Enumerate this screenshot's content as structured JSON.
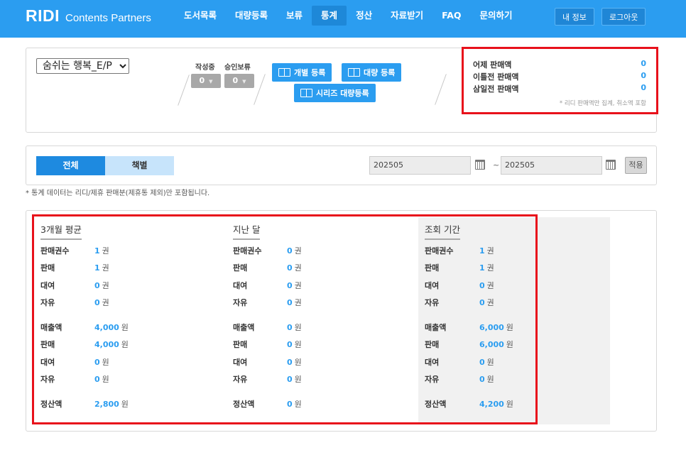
{
  "header": {
    "logo_mark": "RIDI",
    "logo_sub": "Contents Partners",
    "nav": [
      "도서목록",
      "대량등록",
      "보류",
      "통계",
      "정산",
      "자료받기",
      "FAQ",
      "문의하기"
    ],
    "active_nav": "통계",
    "my_info": "내 정보",
    "logout": "로그아웃"
  },
  "publisher": {
    "selected": "숨쉬는 행복_E/P",
    "counters": [
      {
        "label": "작성중",
        "value": "0"
      },
      {
        "label": "승인보류",
        "value": "0"
      }
    ],
    "buttons": {
      "individual": "개별 등록",
      "bulk": "대량 등록",
      "series_bulk": "시리즈 대량등록"
    },
    "sales": [
      {
        "label": "어제 판매액",
        "value": "0"
      },
      {
        "label": "이틀전 판매액",
        "value": "0"
      },
      {
        "label": "삼일전 판매액",
        "value": "0"
      }
    ],
    "sales_note": "* 리디 판매액만 집계, 취소액 포함"
  },
  "filter": {
    "tabs": [
      "전체",
      "책별"
    ],
    "start_date": "202505",
    "tilde": "~",
    "end_date": "202505",
    "apply": "적용"
  },
  "footnote": "* 통계 데이터는 리디/제휴 판매분(제휴통 제외)만 포함됩니다.",
  "stats": {
    "labels": [
      "판매권수",
      "판매",
      "대여",
      "자유",
      "매출액",
      "판매",
      "대여",
      "자유",
      "정산액"
    ],
    "columns": [
      {
        "title": "3개월 평균",
        "values": [
          {
            "n": "1",
            "u": "권"
          },
          {
            "n": "1",
            "u": "권"
          },
          {
            "n": "0",
            "u": "권"
          },
          {
            "n": "0",
            "u": "권"
          },
          {
            "n": "4,000",
            "u": "원"
          },
          {
            "n": "4,000",
            "u": "원"
          },
          {
            "n": "0",
            "u": "원"
          },
          {
            "n": "0",
            "u": "원"
          },
          {
            "n": "2,800",
            "u": "원"
          }
        ]
      },
      {
        "title": "지난 달",
        "values": [
          {
            "n": "0",
            "u": "권"
          },
          {
            "n": "0",
            "u": "권"
          },
          {
            "n": "0",
            "u": "권"
          },
          {
            "n": "0",
            "u": "권"
          },
          {
            "n": "0",
            "u": "원"
          },
          {
            "n": "0",
            "u": "원"
          },
          {
            "n": "0",
            "u": "원"
          },
          {
            "n": "0",
            "u": "원"
          },
          {
            "n": "0",
            "u": "원"
          }
        ]
      },
      {
        "title": "조회 기간",
        "values": [
          {
            "n": "1",
            "u": "권"
          },
          {
            "n": "1",
            "u": "권"
          },
          {
            "n": "0",
            "u": "권"
          },
          {
            "n": "0",
            "u": "권"
          },
          {
            "n": "6,000",
            "u": "원"
          },
          {
            "n": "6,000",
            "u": "원"
          },
          {
            "n": "0",
            "u": "원"
          },
          {
            "n": "0",
            "u": "원"
          },
          {
            "n": "4,200",
            "u": "원"
          }
        ]
      }
    ]
  },
  "colors": {
    "brand_blue": "#2b9df0",
    "highlight_red": "#e8111b"
  }
}
